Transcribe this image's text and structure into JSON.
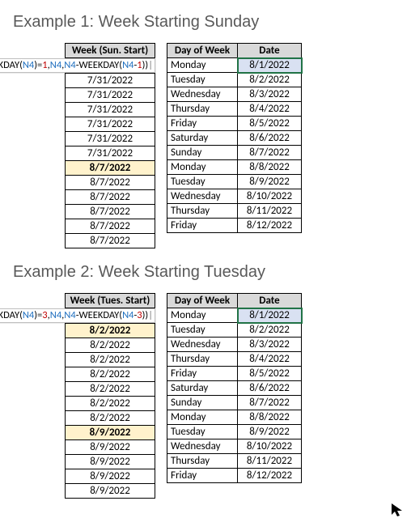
{
  "example1": {
    "title": "Example 1: Week Starting Sunday",
    "week_header": "Week (Sun. Start)",
    "formula_segments": [
      "=IF(WEEKDAY(",
      "N4",
      ")=",
      "1",
      ",",
      "N4",
      ",",
      "N4",
      "-WEEKDAY(",
      "N4",
      "-",
      "1",
      "))"
    ],
    "week_values": [
      "7/31/2022",
      "7/31/2022",
      "7/31/2022",
      "7/31/2022",
      "7/31/2022",
      "7/31/2022",
      "8/7/2022",
      "8/7/2022",
      "8/7/2022",
      "8/7/2022",
      "8/7/2022",
      "8/7/2022"
    ],
    "week_highlight_rows": [
      6
    ],
    "day_header": "Day of Week",
    "date_header": "Date",
    "days": [
      "Monday",
      "Tuesday",
      "Wednesday",
      "Thursday",
      "Friday",
      "Saturday",
      "Sunday",
      "Monday",
      "Tuesday",
      "Wednesday",
      "Thursday",
      "Friday"
    ],
    "dates": [
      "8/1/2022",
      "8/2/2022",
      "8/3/2022",
      "8/4/2022",
      "8/5/2022",
      "8/6/2022",
      "8/7/2022",
      "8/8/2022",
      "8/9/2022",
      "8/10/2022",
      "8/11/2022",
      "8/12/2022"
    ],
    "date_selected_row": 0
  },
  "example2": {
    "title": "Example 2: Week Starting Tuesday",
    "week_header": "Week (Tues. Start)",
    "formula_segments": [
      "=IF(WEEKDAY(",
      "N4",
      ")=",
      "3",
      ",",
      "N4",
      ",",
      "N4",
      "-WEEKDAY(",
      "N4",
      "-",
      "3",
      "))"
    ],
    "week_values": [
      "8/2/2022",
      "8/2/2022",
      "8/2/2022",
      "8/2/2022",
      "8/2/2022",
      "8/2/2022",
      "8/2/2022",
      "8/9/2022",
      "8/9/2022",
      "8/9/2022",
      "8/9/2022",
      "8/9/2022"
    ],
    "week_highlight_rows": [
      0,
      7
    ],
    "day_header": "Day of Week",
    "date_header": "Date",
    "days": [
      "Monday",
      "Tuesday",
      "Wednesday",
      "Thursday",
      "Friday",
      "Saturday",
      "Sunday",
      "Monday",
      "Tuesday",
      "Wednesday",
      "Thursday",
      "Friday"
    ],
    "dates": [
      "8/1/2022",
      "8/2/2022",
      "8/3/2022",
      "8/4/2022",
      "8/5/2022",
      "8/6/2022",
      "8/7/2022",
      "8/8/2022",
      "8/9/2022",
      "8/10/2022",
      "8/11/2022",
      "8/12/2022"
    ],
    "date_selected_row": 0
  }
}
